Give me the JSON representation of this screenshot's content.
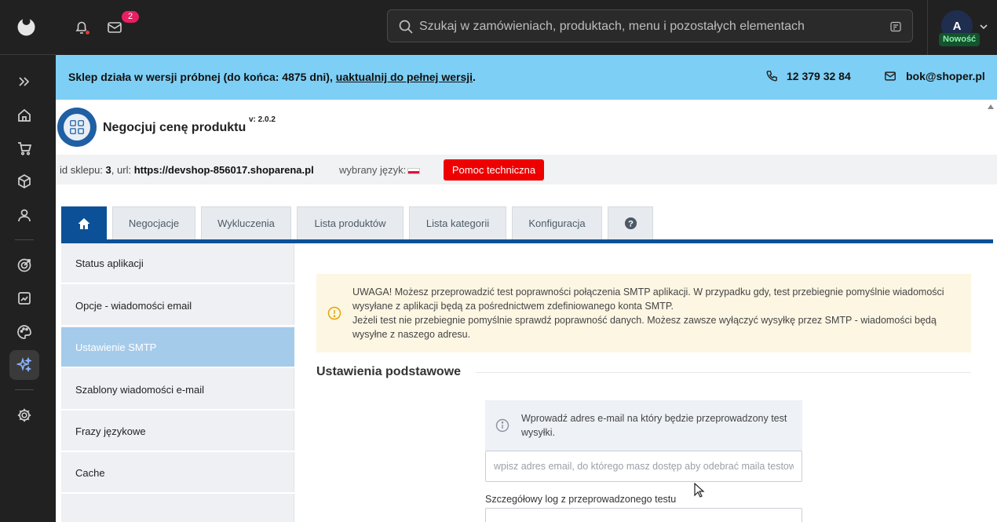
{
  "topbar": {
    "mail_badge": "2",
    "search_placeholder": "Szukaj w zamówieniach, produktach, menu i pozostałych elementach",
    "avatar_initial": "A",
    "new_label": "Nowość"
  },
  "trial": {
    "message": "Sklep działa w wersji próbnej (do końca: 4875 dni), ",
    "upgrade_link": "uaktualnij do pełnej wersji",
    "suffix": ".",
    "phone": "12 379 32 84",
    "email": "bok@shoper.pl"
  },
  "app": {
    "title": "Negocjuj cenę produktu",
    "version": "v: 2.0.2",
    "shop_id_label": "id sklepu: ",
    "shop_id": "3",
    "url_label": ", url: ",
    "url": "https://devshop-856017.shoparena.pl",
    "lang_label": "wybrany język:",
    "help_button": "Pomoc techniczna"
  },
  "tabs": [
    "Negocjacje",
    "Wykluczenia",
    "Lista produktów",
    "Lista kategorii",
    "Konfiguracja"
  ],
  "sidemenu": [
    "Status aplikacji",
    "Opcje - wiadomości email",
    "Ustawienie SMTP",
    "Szablony wiadomości e-mail",
    "Frazy językowe",
    "Cache"
  ],
  "content": {
    "alert_line1": "UWAGA! Możesz przeprowadzić test poprawności połączenia SMTP aplikacji. W przypadku gdy, test przebiegnie pomyślnie wiadomości wysyłane z aplikacji będą za pośrednictwem zdefiniowanego konta SMTP.",
    "alert_line2": "Jeżeli test nie przebiegnie pomyślnie sprawdź poprawność danych. Możesz zawsze wyłączyć wysyłkę przez SMTP - wiadomości będą wysyłne z naszego adresu.",
    "section_title": "Ustawienia podstawowe",
    "info_text": "Wprowadź adres e-mail na który będzie przeprowadzony test wysyłki.",
    "email_placeholder": "wpisz adres email, do którego masz dostęp aby odebrać maila testowego",
    "log_label": "Szczegółowy log z przeprowadzonego testu"
  },
  "colors": {
    "dark": "#212121",
    "banner": "#7ecff5",
    "brand_blue": "#0c5197",
    "active_menu": "#a5cbeb",
    "help_red": "#ee0000",
    "alert_bg": "#fdf6e3"
  }
}
